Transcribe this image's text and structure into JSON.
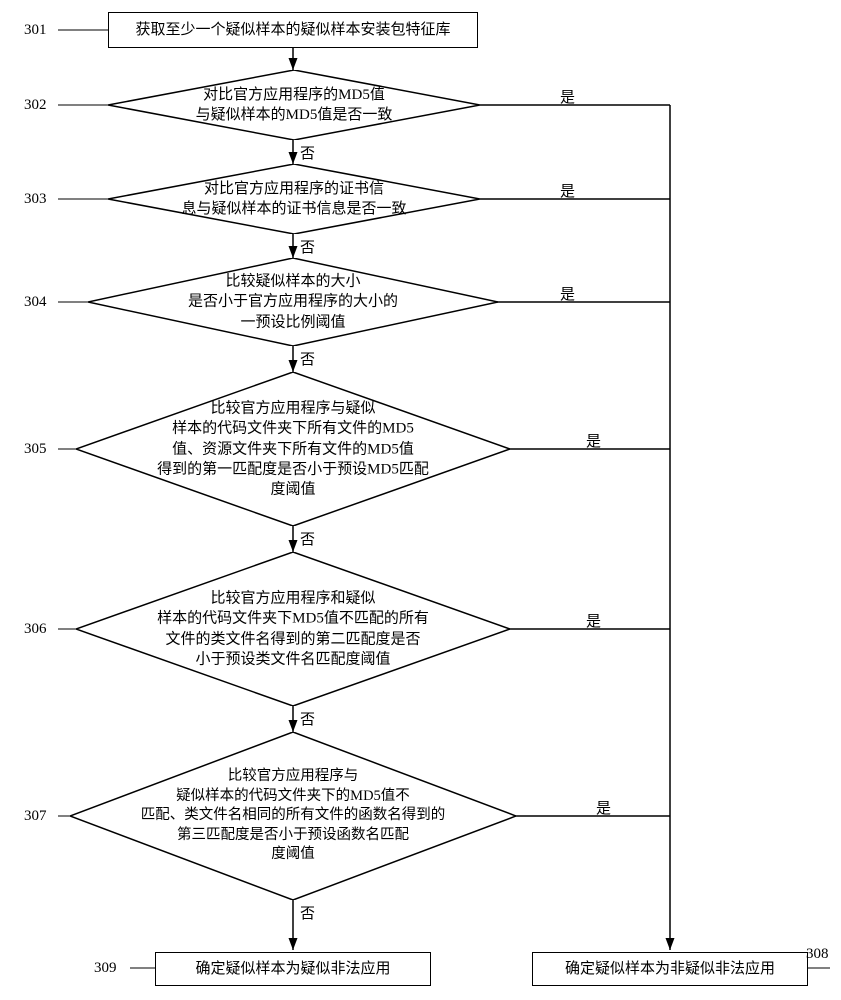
{
  "nodes": {
    "n301": {
      "num": "301",
      "text": "获取至少一个疑似样本的疑似样本安装包特征库"
    },
    "n302": {
      "num": "302",
      "text": "对比官方应用程序的MD5值\n与疑似样本的MD5值是否一致"
    },
    "n303": {
      "num": "303",
      "text": "对比官方应用程序的证书信\n息与疑似样本的证书信息是否一致"
    },
    "n304": {
      "num": "304",
      "text": "比较疑似样本的大小\n是否小于官方应用程序的大小的\n一预设比例阈值"
    },
    "n305": {
      "num": "305",
      "text": "比较官方应用程序与疑似\n样本的代码文件夹下所有文件的MD5\n值、资源文件夹下所有文件的MD5值\n得到的第一匹配度是否小于预设MD5匹配\n度阈值"
    },
    "n306": {
      "num": "306",
      "text": "比较官方应用程序和疑似\n样本的代码文件夹下MD5值不匹配的所有\n文件的类文件名得到的第二匹配度是否\n小于预设类文件名匹配度阈值"
    },
    "n307": {
      "num": "307",
      "text": "比较官方应用程序与\n疑似样本的代码文件夹下的MD5值不\n匹配、类文件名相同的所有文件的函数名得到的\n第三匹配度是否小于预设函数名匹配\n度阈值"
    },
    "n308": {
      "num": "308",
      "text": "确定疑似样本为非疑似非法应用"
    },
    "n309": {
      "num": "309",
      "text": "确定疑似样本为疑似非法应用"
    }
  },
  "labels": {
    "yes": "是",
    "no": "否"
  }
}
